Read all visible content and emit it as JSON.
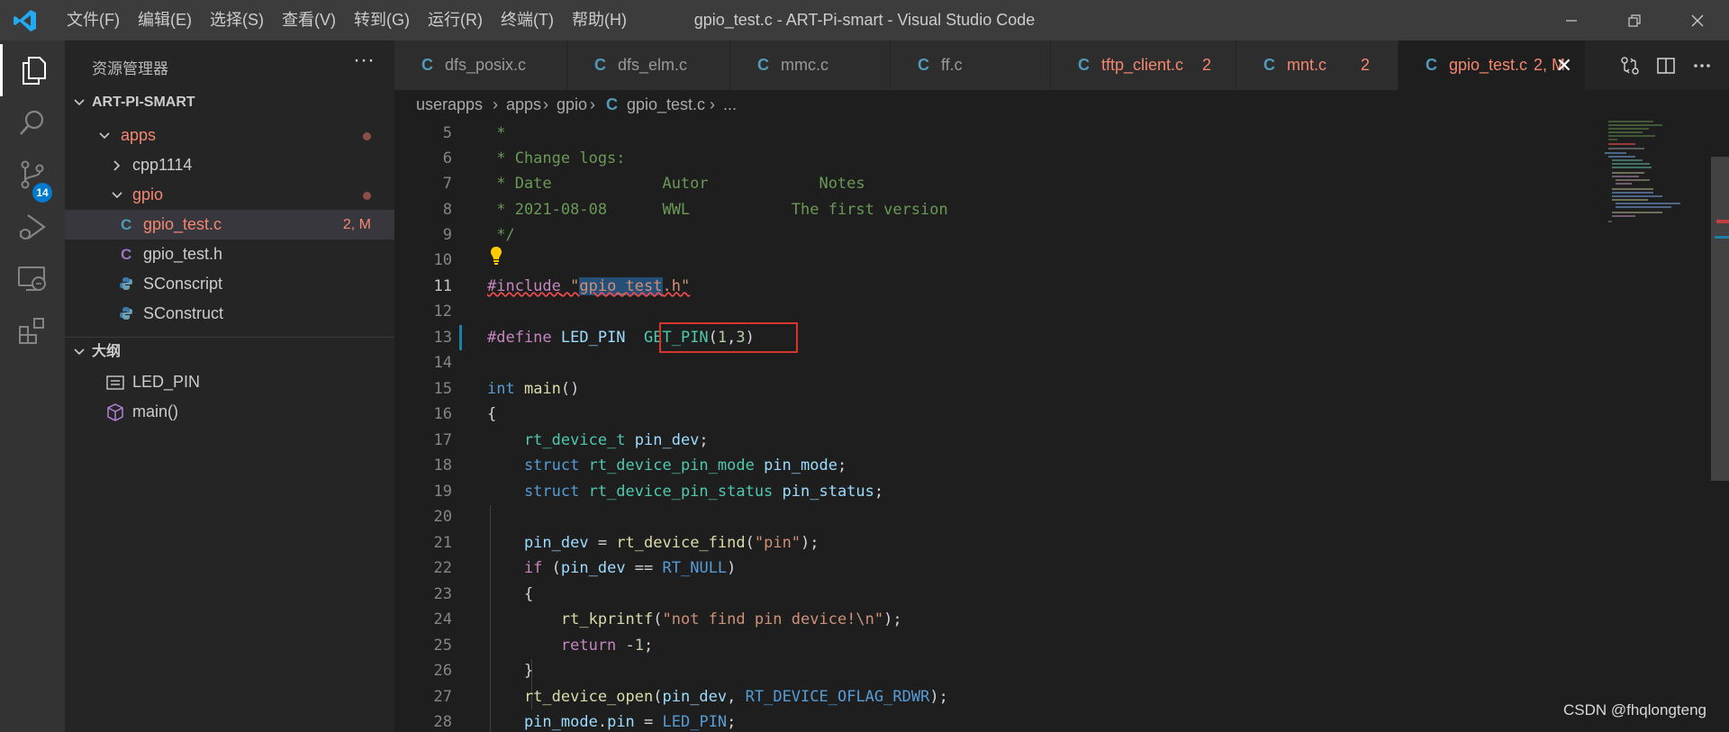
{
  "titlebar": {
    "menu": [
      "文件(F)",
      "编辑(E)",
      "选择(S)",
      "查看(V)",
      "转到(G)",
      "运行(R)",
      "终端(T)",
      "帮助(H)"
    ],
    "window_title": "gpio_test.c - ART-Pi-smart - Visual Studio Code"
  },
  "activity": {
    "scm_badge": "14"
  },
  "sidebar": {
    "title": "资源管理器",
    "more": "···",
    "workspace_title": "ART-PI-SMART",
    "tree": [
      {
        "label": "apps",
        "type": "folder",
        "open": true,
        "modified": true
      },
      {
        "label": "cpp1114",
        "type": "folder",
        "open": false
      },
      {
        "label": "gpio",
        "type": "folder",
        "open": true,
        "modified": true
      },
      {
        "label": "gpio_test.c",
        "type": "c",
        "status": "2, M",
        "selected": true
      },
      {
        "label": "gpio_test.h",
        "type": "h"
      },
      {
        "label": "SConscript",
        "type": "python"
      },
      {
        "label": "SConstruct",
        "type": "python"
      }
    ],
    "outline_title": "大纲",
    "outline": [
      {
        "label": "LED_PIN",
        "kind": "constant"
      },
      {
        "label": "main()",
        "kind": "function"
      }
    ]
  },
  "tabs": [
    {
      "icon": "C",
      "label": "dfs_posix.c"
    },
    {
      "icon": "C",
      "label": "dfs_elm.c"
    },
    {
      "icon": "C",
      "label": "mmc.c"
    },
    {
      "icon": "C",
      "label": "ff.c"
    },
    {
      "icon": "C",
      "label": "tftp_client.c",
      "badge": "2"
    },
    {
      "icon": "C",
      "label": "mnt.c",
      "badge": "2"
    },
    {
      "icon": "C",
      "label": "gpio_test.c",
      "badge": "2, M",
      "active": true,
      "close": "✕"
    }
  ],
  "breadcrumb": [
    "userapps",
    "apps",
    "gpio",
    "gpio_test.c",
    "..."
  ],
  "editor": {
    "line_numbers": [
      "5",
      "6",
      "7",
      "8",
      "9",
      "10",
      "11",
      "12",
      "13",
      "14",
      "15",
      "16",
      "17",
      "18",
      "19",
      "20",
      "21",
      "22",
      "23",
      "24",
      "25",
      "26",
      "27",
      "28"
    ],
    "current_line": "11",
    "code": {
      "l5": " *",
      "l6": " * Change logs:",
      "l7": " * Date            Autor            Notes",
      "l8": " * 2021-08-08      WWL           The first version",
      "l9": " */",
      "l11_pp": "#include",
      "l11_q1": " \"",
      "l11_hl": "gpio_test",
      "l11_q2": ".h\"",
      "l13_pp": "#define",
      "l13_name": " LED_PIN  ",
      "l13_macro": "GET_PIN",
      "l13_p1": "(",
      "l13_n1": "1",
      "l13_c": ",",
      "l13_n2": "3",
      "l13_p2": ")",
      "l15_kw": "int",
      "l15_fn": " main",
      "l15_p": "()",
      "l16": "{",
      "l17_ty": "    rt_device_t",
      "l17_vr": " pin_dev",
      "l17_p": ";",
      "l18_kw": "    struct",
      "l18_ty": " rt_device_pin_mode",
      "l18_vr": " pin_mode",
      "l18_p": ";",
      "l19_kw": "    struct",
      "l19_ty": " rt_device_pin_status",
      "l19_vr": " pin_status",
      "l19_p": ";",
      "l21_vr": "    pin_dev",
      "l21_op": " = ",
      "l21_fn": "rt_device_find",
      "l21_p1": "(",
      "l21_st": "\"pin\"",
      "l21_p2": ");",
      "l22_kw": "    if",
      "l22_p1": " (",
      "l22_vr": "pin_dev",
      "l22_op": " == ",
      "l22_mc": "RT_NULL",
      "l22_p2": ")",
      "l23": "    {",
      "l24_fn": "        rt_kprintf",
      "l24_p1": "(",
      "l24_st": "\"not find pin device!\\n\"",
      "l24_p2": ");",
      "l25_kw": "        return",
      "l25_p": " -",
      "l25_nm": "1",
      "l25_e": ";",
      "l26": "    }",
      "l27_fn": "    rt_device_open",
      "l27_p1": "(",
      "l27_vr": "pin_dev",
      "l27_c": ", ",
      "l27_mc": "RT_DEVICE_OFLAG_RDWR",
      "l27_p2": ");",
      "l28_vr": "    pin_mode",
      "l28_d": ".",
      "l28_vr2": "pin",
      "l28_op": " = ",
      "l28_mc": "LED_PIN",
      "l28_e": ";"
    }
  },
  "watermark": "CSDN @fhqlongteng",
  "colors": {
    "accent": "#007acc",
    "modified": "#e2c08d",
    "error": "#f48771",
    "highlight_box": "#d7352e"
  }
}
